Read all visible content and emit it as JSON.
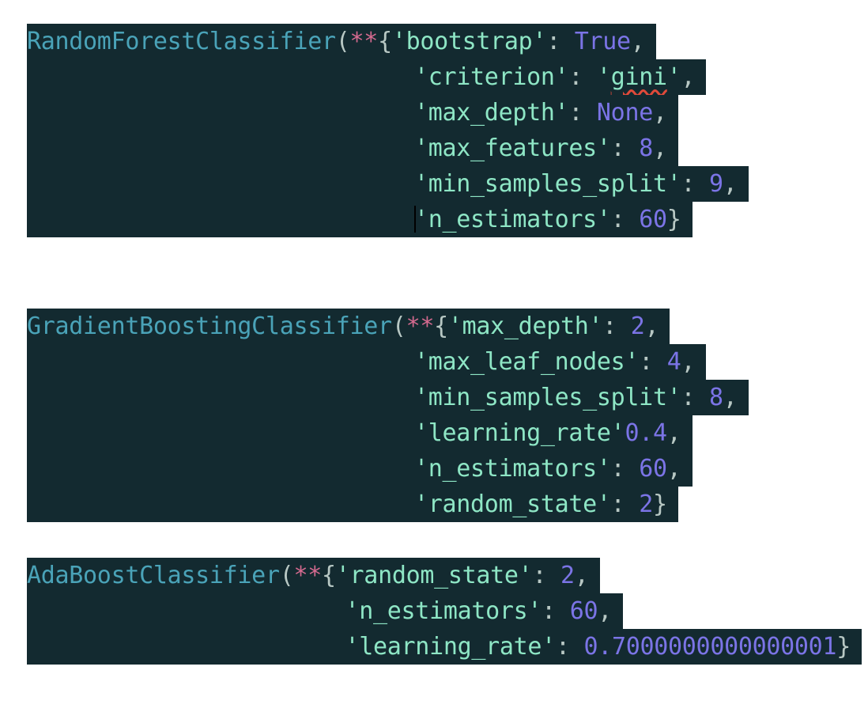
{
  "blocks": [
    {
      "name": "RandomForestClassifier",
      "lines": [
        [
          [
            "cls",
            "RandomForestClassifier"
          ],
          [
            "pn",
            "("
          ],
          [
            "op",
            "**"
          ],
          [
            "pn",
            "{"
          ],
          [
            "str",
            "'bootstrap'"
          ],
          [
            "pn",
            ": "
          ],
          [
            "kw",
            "True"
          ],
          [
            "pn",
            ","
          ]
        ],
        [
          [
            "pad",
            28
          ],
          [
            "str",
            "'criterion'"
          ],
          [
            "pn",
            ": "
          ],
          [
            "str",
            "'"
          ],
          [
            "squig",
            "gini"
          ],
          [
            "str",
            "'"
          ],
          [
            "pn",
            ","
          ]
        ],
        [
          [
            "pad",
            28
          ],
          [
            "str",
            "'max_depth'"
          ],
          [
            "pn",
            ": "
          ],
          [
            "kw",
            "None"
          ],
          [
            "pn",
            ","
          ]
        ],
        [
          [
            "pad",
            28
          ],
          [
            "str",
            "'max_features'"
          ],
          [
            "pn",
            ": "
          ],
          [
            "num",
            "8"
          ],
          [
            "pn",
            ","
          ]
        ],
        [
          [
            "pad",
            28
          ],
          [
            "str",
            "'min_samples_split'"
          ],
          [
            "pn",
            ": "
          ],
          [
            "num",
            "9"
          ],
          [
            "pn",
            ","
          ]
        ],
        [
          [
            "pad",
            28
          ],
          [
            "str",
            "'n_estimators'"
          ],
          [
            "pn",
            ": "
          ],
          [
            "num",
            "60"
          ],
          [
            "pn",
            "}"
          ]
        ]
      ]
    },
    {
      "name": "GradientBoostingClassifier",
      "lines": [
        [
          [
            "cls",
            "GradientBoostingClassifier"
          ],
          [
            "pn",
            "("
          ],
          [
            "op",
            "**"
          ],
          [
            "pn",
            "{"
          ],
          [
            "str",
            "'max_depth'"
          ],
          [
            "pn",
            ": "
          ],
          [
            "num",
            "2"
          ],
          [
            "pn",
            ","
          ]
        ],
        [
          [
            "pad",
            28
          ],
          [
            "str",
            "'max_leaf_nodes'"
          ],
          [
            "pn",
            ": "
          ],
          [
            "num",
            "4"
          ],
          [
            "pn",
            ","
          ]
        ],
        [
          [
            "pad",
            28
          ],
          [
            "str",
            "'min_samples_split'"
          ],
          [
            "pn",
            ": "
          ],
          [
            "num",
            "8"
          ],
          [
            "pn",
            ","
          ]
        ],
        [
          [
            "pad",
            28
          ],
          [
            "str",
            "'learning_rate'"
          ],
          [
            "num",
            "0.4"
          ],
          [
            "pn",
            ","
          ]
        ],
        [
          [
            "pad",
            28
          ],
          [
            "str",
            "'n_estimators'"
          ],
          [
            "pn",
            ": "
          ],
          [
            "num",
            "60"
          ],
          [
            "pn",
            ","
          ]
        ],
        [
          [
            "pad",
            28
          ],
          [
            "str",
            "'random_state'"
          ],
          [
            "pn",
            ": "
          ],
          [
            "num",
            "2"
          ],
          [
            "pn",
            "}"
          ]
        ]
      ]
    },
    {
      "name": "AdaBoostClassifier",
      "lines": [
        [
          [
            "cls",
            "AdaBoostClassifier"
          ],
          [
            "pn",
            "("
          ],
          [
            "op",
            "**"
          ],
          [
            "pn",
            "{"
          ],
          [
            "str",
            "'random_state'"
          ],
          [
            "pn",
            ": "
          ],
          [
            "num",
            "2"
          ],
          [
            "pn",
            ","
          ]
        ],
        [
          [
            "pad",
            23
          ],
          [
            "str",
            "'n_estimators'"
          ],
          [
            "pn",
            ": "
          ],
          [
            "num",
            "60"
          ],
          [
            "pn",
            ","
          ]
        ],
        [
          [
            "pad",
            23
          ],
          [
            "str",
            "'learning_rate'"
          ],
          [
            "pn",
            ": "
          ],
          [
            "num",
            "0.7000000000000001"
          ],
          [
            "pn",
            "}"
          ]
        ]
      ]
    }
  ],
  "colors": {
    "background": "#132a30",
    "class_name": "#4aa3b8",
    "string": "#8ee6c5",
    "number": "#7b74e6",
    "operator": "#d46a8f",
    "punctuation": "#b8c8c4"
  }
}
